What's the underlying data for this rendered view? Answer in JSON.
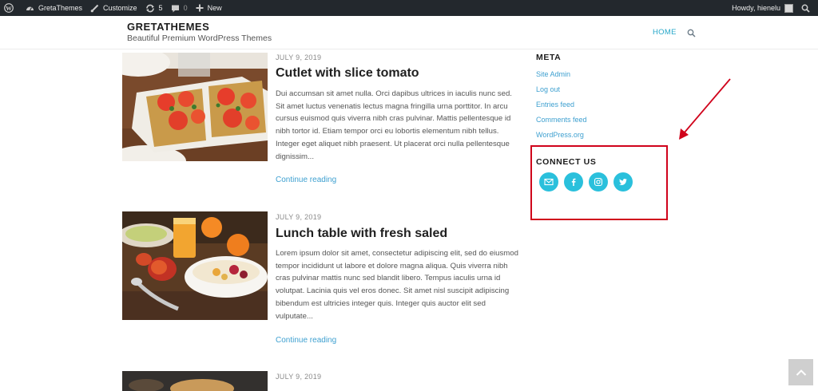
{
  "adminbar": {
    "site_name": "GretaThemes",
    "customize": "Customize",
    "updates_count": "5",
    "comments_count": "0",
    "new_label": "New",
    "howdy": "Howdy, hienelu"
  },
  "header": {
    "title": "GRETATHEMES",
    "description": "Beautiful Premium WordPress Themes",
    "nav_home": "HOME"
  },
  "posts": [
    {
      "date": "JULY 9, 2019",
      "title": "Cutlet with slice tomato",
      "excerpt": "Dui accumsan sit amet nulla. Orci dapibus ultrices in iaculis nunc sed. Sit amet luctus venenatis lectus magna fringilla urna porttitor. In arcu cursus euismod quis viverra nibh cras pulvinar. Mattis pellentesque id nibh tortor id. Etiam tempor orci eu lobortis elementum nibh tellus. Integer eget aliquet nibh praesent. Ut placerat orci nulla pellentesque dignissim...",
      "more": "Continue reading"
    },
    {
      "date": "JULY 9, 2019",
      "title": "Lunch table with fresh saled",
      "excerpt": "Lorem ipsum dolor sit amet, consectetur adipiscing elit, sed do eiusmod tempor incididunt ut labore et dolore magna aliqua. Quis viverra nibh cras pulvinar mattis nunc sed blandit libero. Tempus iaculis urna id volutpat. Lacinia quis vel eros donec. Sit amet nisl suscipit adipiscing bibendum est ultricies integer quis. Integer quis auctor elit sed vulputate...",
      "more": "Continue reading"
    },
    {
      "date": "JULY 9, 2019"
    }
  ],
  "sidebar": {
    "meta_title": "META",
    "meta_links": [
      "Site Admin",
      "Log out",
      "Entries feed",
      "Comments feed",
      "WordPress.org"
    ],
    "connect_title": "CONNECT US",
    "social_icons": [
      "email-icon",
      "facebook-icon",
      "instagram-icon",
      "twitter-icon"
    ]
  },
  "colors": {
    "accent": "#3ea0d0",
    "social": "#2ac0dc",
    "admin_bar": "#23282d",
    "highlight": "#d0021b"
  }
}
